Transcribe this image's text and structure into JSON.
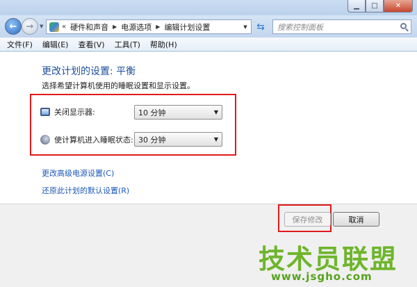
{
  "window": {
    "minimize_icon": "minimize-icon",
    "maximize_icon": "maximize-icon",
    "close_icon": "close-icon"
  },
  "navbar": {
    "breadcrumb": [
      "硬件和声音",
      "电源选项",
      "编辑计划设置"
    ],
    "search_placeholder": "搜索控制面板"
  },
  "menubar": {
    "items": [
      "文件(F)",
      "编辑(E)",
      "查看(V)",
      "工具(T)",
      "帮助(H)"
    ]
  },
  "main": {
    "title": "更改计划的设置: 平衡",
    "subtitle": "选择希望计算机使用的睡眠设置和显示设置。",
    "settings": [
      {
        "label": "关闭显示器:",
        "value": "10 分钟",
        "icon": "monitor-icon"
      },
      {
        "label": "使计算机进入睡眠状态:",
        "value": "30 分钟",
        "icon": "sleep-icon"
      }
    ],
    "links": [
      "更改高级电源设置(C)",
      "还原此计划的默认设置(R)"
    ]
  },
  "footer": {
    "save_label": "保存修改",
    "cancel_label": "取消"
  },
  "watermark": {
    "main": "技术员联盟",
    "url": "www.jsgho.com"
  },
  "colors": {
    "title": "#1d4f9c",
    "link": "#1a57b8",
    "highlight": "#e01a1a",
    "watermark": "#6fb52c"
  }
}
